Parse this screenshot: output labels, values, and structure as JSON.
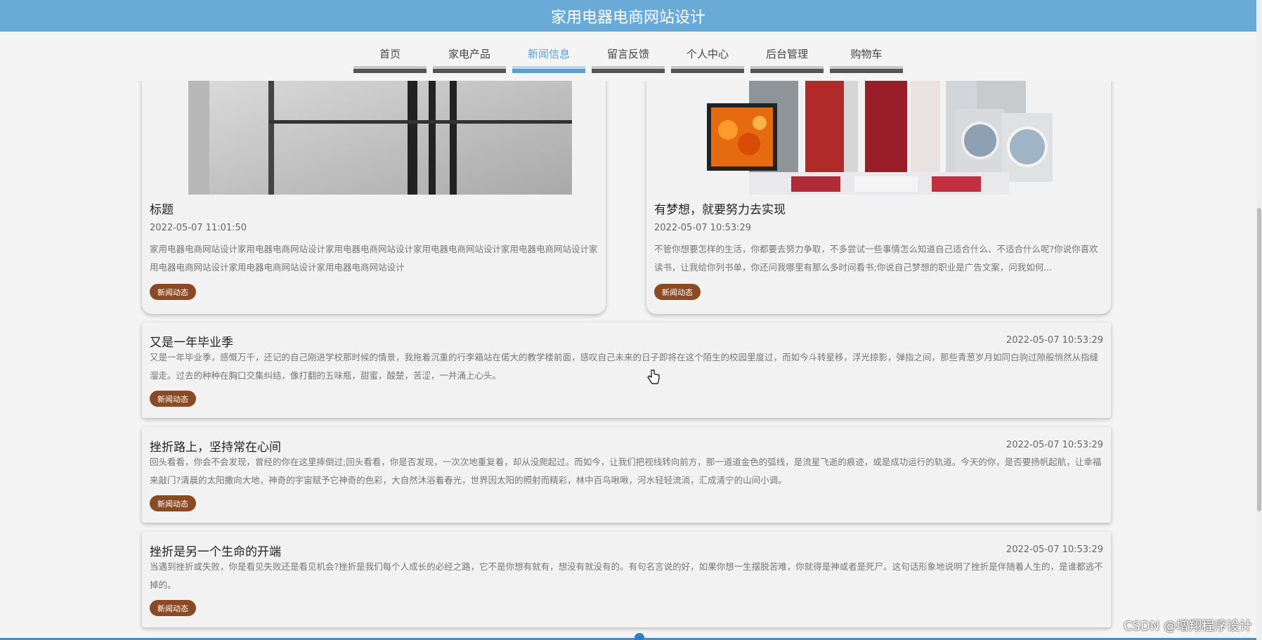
{
  "header": {
    "title": "家用电器电商网站设计"
  },
  "nav": {
    "items": [
      {
        "label": "首页"
      },
      {
        "label": "家电产品"
      },
      {
        "label": "新闻信息"
      },
      {
        "label": "留言反馈"
      },
      {
        "label": "个人中心"
      },
      {
        "label": "后台管理"
      },
      {
        "label": "购物车"
      }
    ],
    "active": "新闻信息"
  },
  "featured": [
    {
      "title": "标题",
      "date": "2022-05-07 11:01:50",
      "desc": "家用电器电商网站设计家用电器电商网站设计家用电器电商网站设计家用电器电商网站设计家用电器电商网站设计家用电器电商网站设计家用电器电商网站设计家用电器电商网站设计",
      "tag": "新闻动态"
    },
    {
      "title": "有梦想，就要努力去实现",
      "date": "2022-05-07 10:53:29",
      "desc": "不管你想要怎样的生活，你都要去努力争取，不多尝试一些事情怎么知道自己适合什么、不适合什么呢?你说你喜欢读书，让我给你列书单，你还问我哪里有那么多时间看书;你说自己梦想的职业是广告文案，问我如何...",
      "tag": "新闻动态"
    }
  ],
  "news": [
    {
      "title": "又是一年毕业季",
      "date": "2022-05-07 10:53:29",
      "desc": "又是一年毕业季，感慨万千，还记的自己刚进学校那时候的情景，我拖着沉重的行李箱站在偌大的教学楼前面，感叹自己未来的日子即将在这个陌生的校园里度过，而如今斗转星移，浮光掠影，弹指之间，那些青葱岁月如同白驹过隙般悄然从指缝溜走。过去的种种在胸口交集纠结，像打翻的五味瓶，甜蜜，酸楚，苦涩，一并涌上心头。",
      "tag": "新闻动态"
    },
    {
      "title": "挫折路上，坚持常在心间",
      "date": "2022-05-07 10:53:29",
      "desc": "回头看看，你会不会发现，曾经的你在这里摔倒过;回头看看，你是否发现，一次次地重复着，却从没爬起过。而如今，让我们把视线转向前方，那一道道金色的弧线，是流星飞逝的痕迹，或是成功运行的轨道。今天的你，是否要扬帆起航，让幸福来敲门?清晨的太阳撒向大地，神奇的宇宙赋予它神奇的色彩，大自然沐浴着春光，世界因太阳的照射而精彩，林中百鸟啾啾，河水轻轻流淌，汇成清宁的山间小调。",
      "tag": "新闻动态"
    },
    {
      "title": "挫折是另一个生命的开端",
      "date": "2022-05-07 10:53:29",
      "desc": "当遇到挫折或失败，你是看见失败还是看见机会?挫折是我们每个人成长的必经之路，它不是你想有就有，想没有就没有的。有句名言说的好，如果你想一生摆脱苦难，你就得是神或者是死尸。这句话形象地说明了挫折是伴随着人生的，是谁都逃不掉的。",
      "tag": "新闻动态"
    }
  ],
  "watermark": "CSDN @增翔程序设计"
}
